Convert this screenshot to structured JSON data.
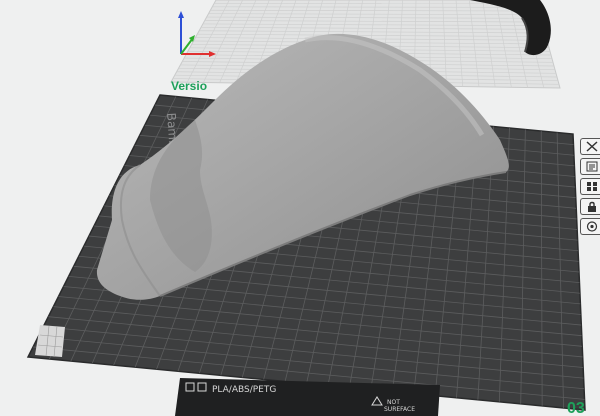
{
  "app": {
    "version_label": "Versio",
    "plate_id": "03"
  },
  "plate": {
    "name_text": "Bambu Textured PEI Plat",
    "filament_text": "PLA/ABS/PETG",
    "surface_text_line1": "NOT",
    "surface_text_line2": "SUREFACE"
  },
  "toolbar": {
    "items": [
      {
        "icon": "close-x-icon"
      },
      {
        "icon": "settings-list-icon"
      },
      {
        "icon": "grid-arrange-icon"
      },
      {
        "icon": "lock-icon"
      },
      {
        "icon": "circle-settings-icon"
      }
    ]
  },
  "colors": {
    "background": "#eff0f0",
    "plate": "#3d3e3f",
    "plate_grid": "#5a5b5c",
    "model": "#a8a8a8",
    "accent_green": "#1ea05a",
    "axis_x": "#e03030",
    "axis_y": "#2fb02f",
    "axis_z": "#2d4fd6"
  }
}
